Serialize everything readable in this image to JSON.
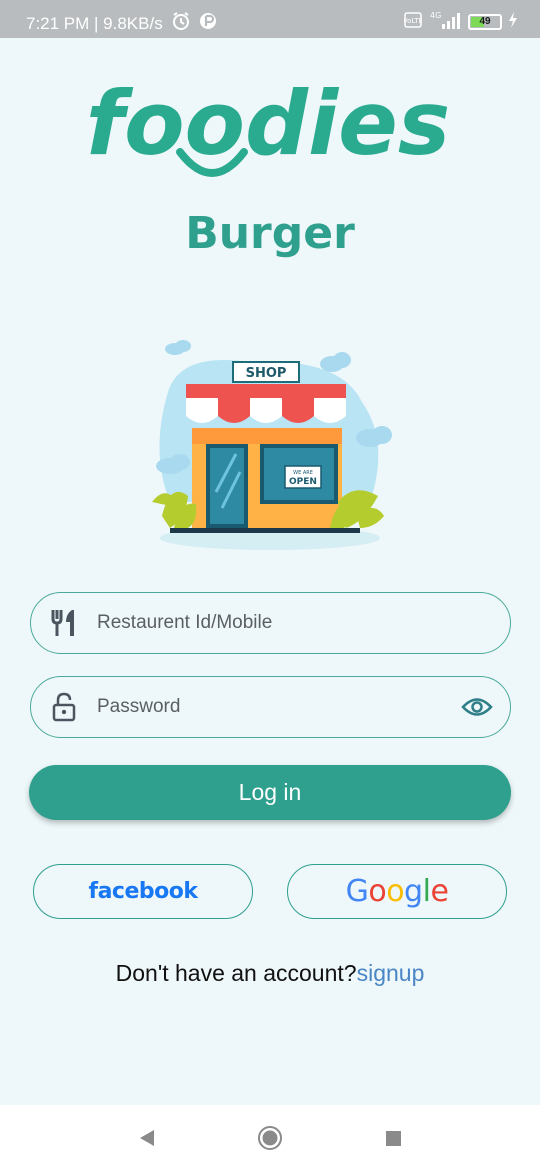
{
  "status_bar": {
    "time_speed": "7:21 PM | 9.8KB/s",
    "network": "4G",
    "volte": "VoLTE",
    "battery": "49"
  },
  "app": {
    "logo_text": "foodies",
    "subtitle": "Burger",
    "brand_color": "#2f9f8e"
  },
  "illustration": {
    "shop_sign": "SHOP",
    "door_sign_small": "WE ARE",
    "door_sign": "OPEN"
  },
  "form": {
    "restaurant_placeholder": "Restaurent Id/Mobile",
    "restaurant_value": "",
    "password_placeholder": "Password",
    "password_value": "",
    "login_label": "Log in"
  },
  "social": {
    "facebook_label": "facebook",
    "google_label": "Google"
  },
  "signup": {
    "prompt": "Don't have an account?",
    "link": "signup"
  },
  "icons": {
    "restaurant_field": "fork-knife-icon",
    "password_field": "lock-icon",
    "password_toggle": "eye-icon",
    "nav_back": "back-triangle-icon",
    "nav_home": "home-circle-icon",
    "nav_recents": "recents-square-icon"
  }
}
